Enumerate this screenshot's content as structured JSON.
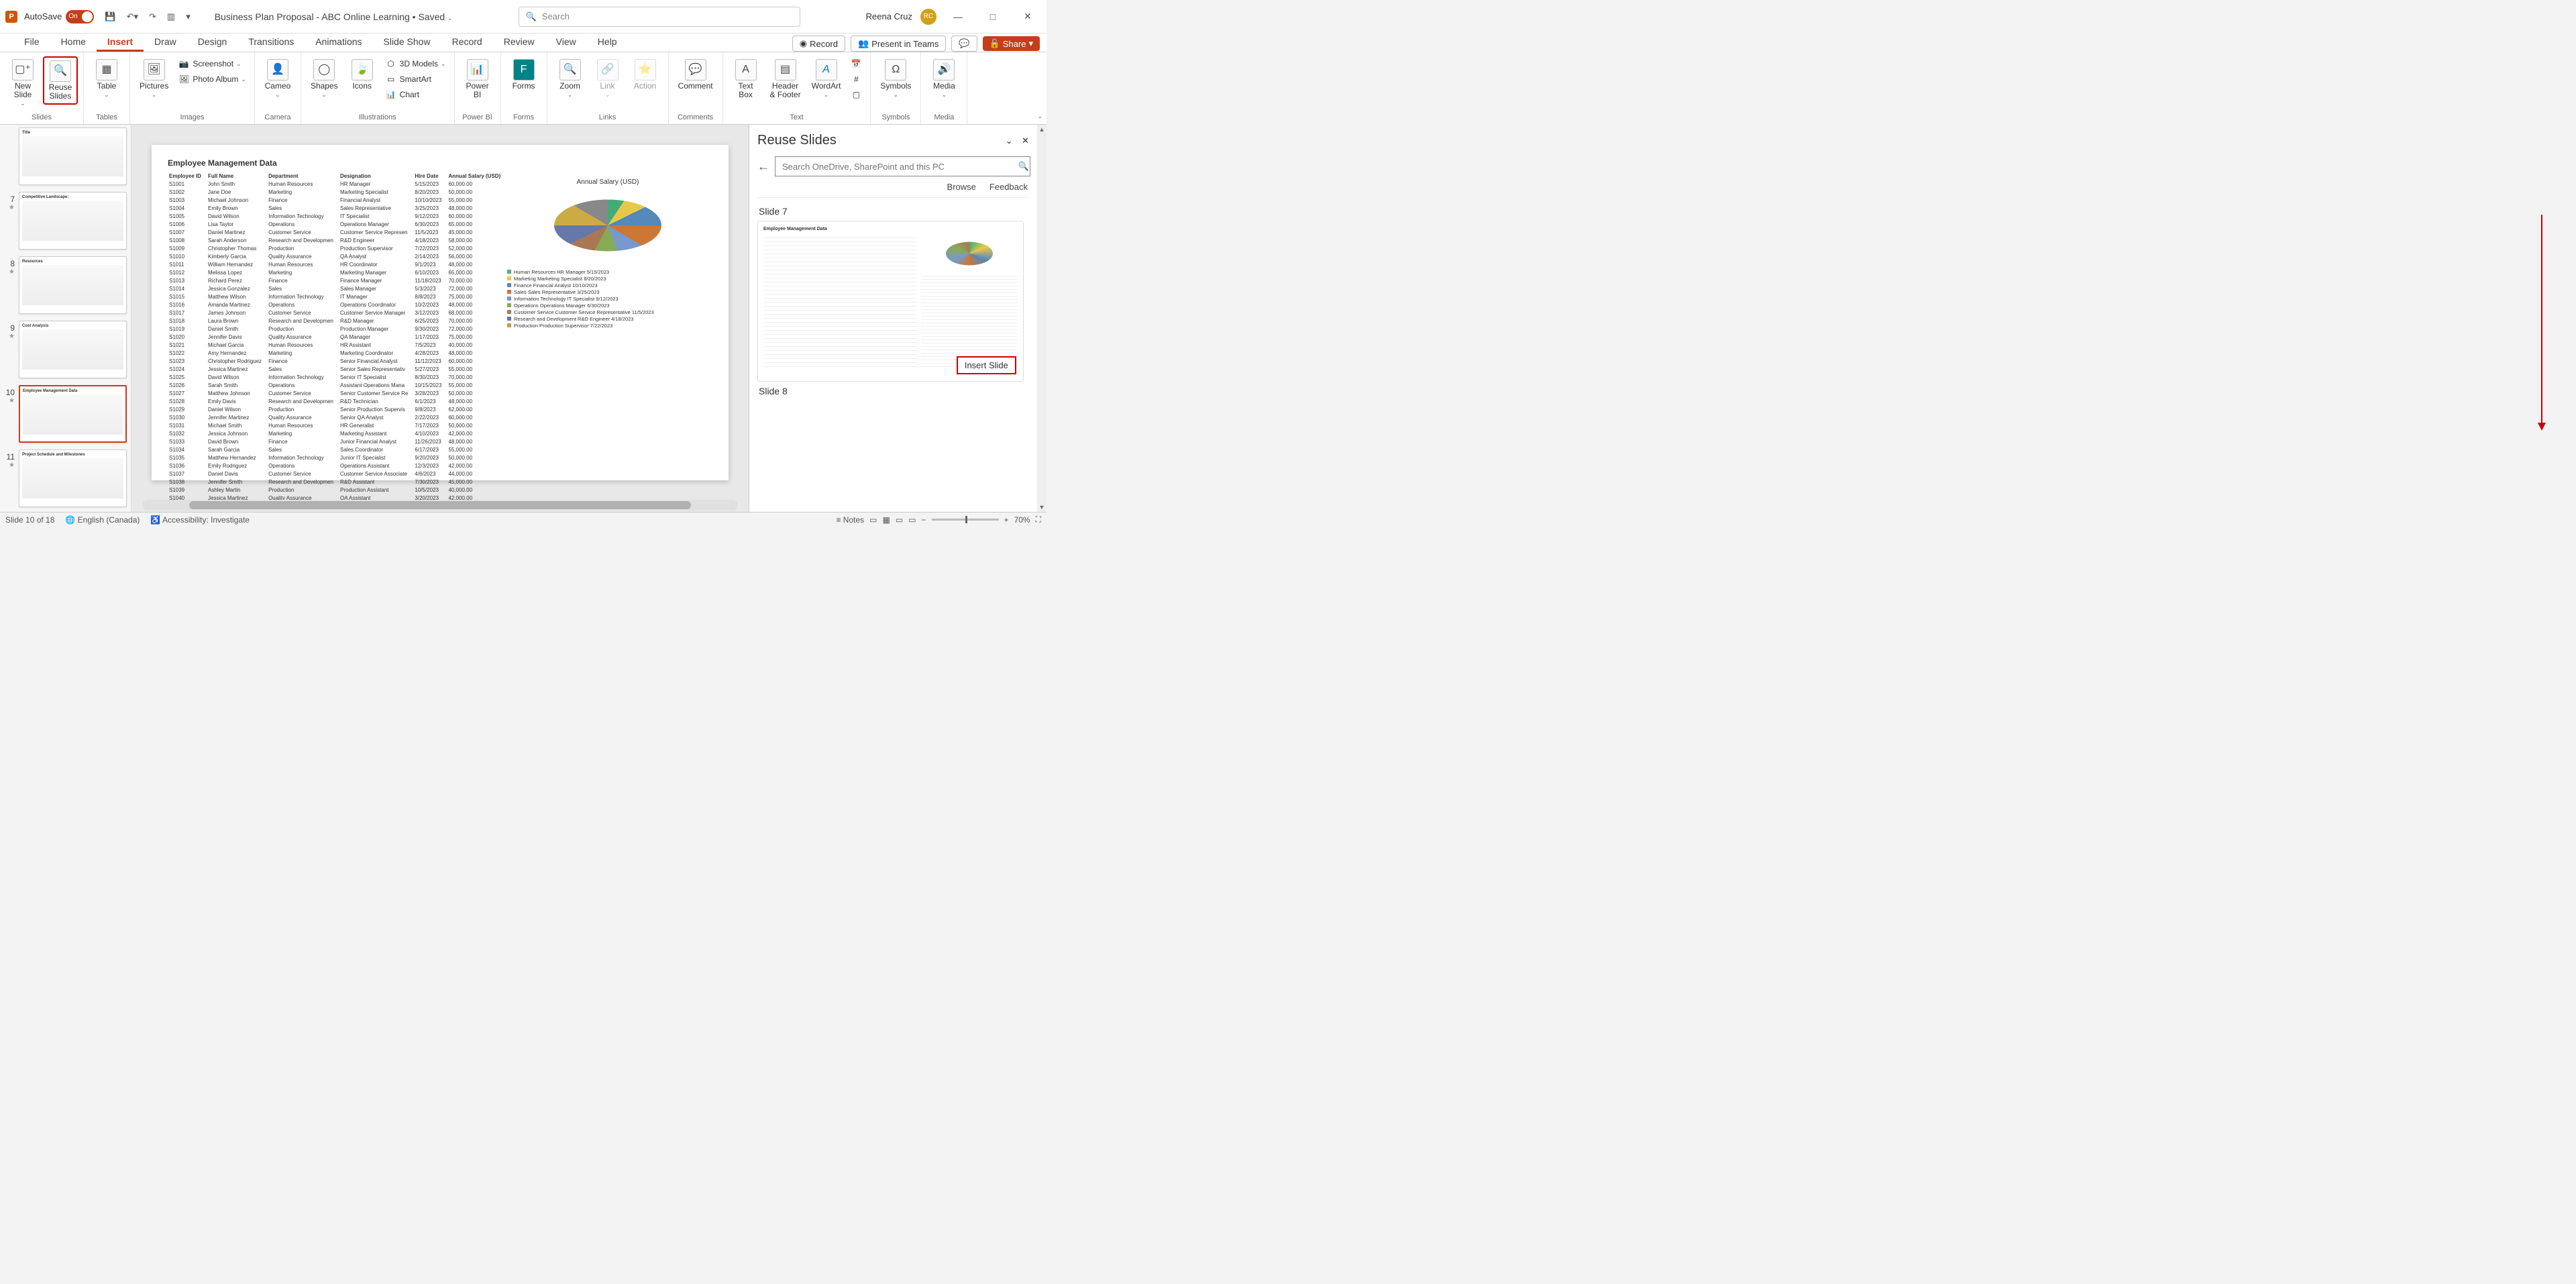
{
  "titlebar": {
    "autosave_label": "AutoSave",
    "autosave_state": "On",
    "doc_title": "Business Plan Proposal - ABC Online Learning • Saved",
    "search_placeholder": "Search",
    "user_name": "Reena Cruz",
    "user_initials": "RC"
  },
  "tabs": {
    "items": [
      "File",
      "Home",
      "Insert",
      "Draw",
      "Design",
      "Transitions",
      "Animations",
      "Slide Show",
      "Record",
      "Review",
      "View",
      "Help"
    ],
    "active": "Insert",
    "record_btn": "Record",
    "present_btn": "Present in Teams",
    "share_btn": "Share"
  },
  "ribbon": {
    "groups": {
      "slides": {
        "label": "Slides",
        "new_slide": "New\nSlide",
        "reuse": "Reuse\nSlides"
      },
      "tables": {
        "label": "Tables",
        "table": "Table"
      },
      "images": {
        "label": "Images",
        "pictures": "Pictures",
        "screenshot": "Screenshot",
        "photo_album": "Photo Album"
      },
      "camera": {
        "label": "Camera",
        "cameo": "Cameo"
      },
      "illustrations": {
        "label": "Illustrations",
        "shapes": "Shapes",
        "icons": "Icons",
        "models": "3D Models",
        "smartart": "SmartArt",
        "chart": "Chart"
      },
      "powerbi": {
        "label": "Power BI",
        "btn": "Power\nBI"
      },
      "forms": {
        "label": "Forms",
        "btn": "Forms"
      },
      "links": {
        "label": "Links",
        "zoom": "Zoom",
        "link": "Link",
        "action": "Action"
      },
      "comments": {
        "label": "Comments",
        "btn": "Comment"
      },
      "text": {
        "label": "Text",
        "textbox": "Text\nBox",
        "headerfooter": "Header\n& Footer",
        "wordart": "WordArt"
      },
      "symbols": {
        "label": "Symbols",
        "btn": "Symbols"
      },
      "media": {
        "label": "Media",
        "btn": "Media"
      }
    }
  },
  "thumbs": {
    "visible": [
      {
        "num": "",
        "title": "Title"
      },
      {
        "num": "7",
        "title": "Competitive Landscape:"
      },
      {
        "num": "8",
        "title": "Resources"
      },
      {
        "num": "9",
        "title": "Cost Analysis"
      },
      {
        "num": "10",
        "title": "Employee Management Data",
        "selected": true
      },
      {
        "num": "11",
        "title": "Project Schedule and Milestones"
      }
    ]
  },
  "slide": {
    "title": "Employee Management Data",
    "columns": [
      "Employee ID",
      "Full Name",
      "Department",
      "Designation",
      "Hire Date",
      "Annual Salary (USD)"
    ],
    "rows": [
      [
        "S1001",
        "John Smith",
        "Human Resources",
        "HR Manager",
        "5/15/2023",
        "60,000.00"
      ],
      [
        "S1002",
        "Jane Doe",
        "Marketing",
        "Marketing Specialist",
        "8/20/2023",
        "50,000.00"
      ],
      [
        "S1003",
        "Michael Johnson",
        "Finance",
        "Financial Analyst",
        "10/10/2023",
        "55,000.00"
      ],
      [
        "S1004",
        "Emily Brown",
        "Sales",
        "Sales Representative",
        "3/25/2023",
        "48,000.00"
      ],
      [
        "S1005",
        "David Wilson",
        "Information Technology",
        "IT Specialist",
        "9/12/2023",
        "60,000.00"
      ],
      [
        "S1006",
        "Lisa Taylor",
        "Operations",
        "Operations Manager",
        "6/30/2023",
        "65,000.00"
      ],
      [
        "S1007",
        "Daniel Martinez",
        "Customer Service",
        "Customer Service Represen",
        "11/5/2023",
        "45,000.00"
      ],
      [
        "S1008",
        "Sarah Anderson",
        "Research and Developmen",
        "R&D Engineer",
        "4/18/2023",
        "58,000.00"
      ],
      [
        "S1009",
        "Christopher Thomas",
        "Production",
        "Production Supervisor",
        "7/22/2023",
        "52,000.00"
      ],
      [
        "S1010",
        "Kimberly Garcia",
        "Quality Assurance",
        "QA Analyst",
        "2/14/2023",
        "56,000.00"
      ],
      [
        "S1011",
        "William Hernandez",
        "Human Resources",
        "HR Coordinator",
        "9/1/2023",
        "48,000.00"
      ],
      [
        "S1012",
        "Melissa Lopez",
        "Marketing",
        "Marketing Manager",
        "6/10/2023",
        "65,000.00"
      ],
      [
        "S1013",
        "Richard Perez",
        "Finance",
        "Finance Manager",
        "11/18/2023",
        "70,000.00"
      ],
      [
        "S1014",
        "Jessica Gonzalez",
        "Sales",
        "Sales Manager",
        "5/3/2023",
        "72,000.00"
      ],
      [
        "S1015",
        "Matthew Wilson",
        "Information Technology",
        "IT Manager",
        "8/8/2023",
        "75,000.00"
      ],
      [
        "S1016",
        "Amanda Martinez",
        "Operations",
        "Operations Coordinator",
        "10/2/2023",
        "48,000.00"
      ],
      [
        "S1017",
        "James Johnson",
        "Customer Service",
        "Customer Service Manager",
        "3/12/2023",
        "68,000.00"
      ],
      [
        "S1018",
        "Laura Brown",
        "Research and Developmen",
        "R&D Manager",
        "6/25/2023",
        "70,000.00"
      ],
      [
        "S1019",
        "Daniel Smith",
        "Production",
        "Production Manager",
        "9/30/2023",
        "72,000.00"
      ],
      [
        "S1020",
        "Jennifer Davis",
        "Quality Assurance",
        "QA Manager",
        "1/17/2023",
        "75,000.00"
      ],
      [
        "S1021",
        "Michael Garcia",
        "Human Resources",
        "HR Assistant",
        "7/5/2023",
        "40,000.00"
      ],
      [
        "S1022",
        "Amy Hernandez",
        "Marketing",
        "Marketing Coordinator",
        "4/28/2023",
        "48,000.00"
      ],
      [
        "S1023",
        "Christopher Rodriguez",
        "Finance",
        "Senior Financial Analyst",
        "11/12/2023",
        "60,000.00"
      ],
      [
        "S1024",
        "Jessica Martinez",
        "Sales",
        "Senior Sales Representativ",
        "5/27/2023",
        "55,000.00"
      ],
      [
        "S1025",
        "David Wilson",
        "Information Technology",
        "Senior IT Specialist",
        "8/30/2023",
        "70,000.00"
      ],
      [
        "S1026",
        "Sarah Smith",
        "Operations",
        "Assistant Operations Mana",
        "10/15/2023",
        "55,000.00"
      ],
      [
        "S1027",
        "Matthew Johnson",
        "Customer Service",
        "Senior Customer Service Re",
        "3/28/2023",
        "50,000.00"
      ],
      [
        "S1028",
        "Emily Davis",
        "Research and Developmen",
        "R&D Technician",
        "6/1/2023",
        "48,000.00"
      ],
      [
        "S1029",
        "Daniel Wilson",
        "Production",
        "Senior Production Supervis",
        "9/8/2023",
        "62,000.00"
      ],
      [
        "S1030",
        "Jennifer Martinez",
        "Quality Assurance",
        "Senior QA Analyst",
        "2/22/2023",
        "60,000.00"
      ],
      [
        "S1031",
        "Michael Smith",
        "Human Resources",
        "HR Generalist",
        "7/17/2023",
        "50,000.00"
      ],
      [
        "S1032",
        "Jessica Johnson",
        "Marketing",
        "Marketing Assistant",
        "4/10/2023",
        "42,000.00"
      ],
      [
        "S1033",
        "David Brown",
        "Finance",
        "Junior Financial Analyst",
        "11/26/2023",
        "48,000.00"
      ],
      [
        "S1034",
        "Sarah Garcia",
        "Sales",
        "Sales Coordinator",
        "6/17/2023",
        "55,000.00"
      ],
      [
        "S1035",
        "Matthew Hernandez",
        "Information Technology",
        "Junior IT Specialist",
        "9/20/2023",
        "50,000.00"
      ],
      [
        "S1036",
        "Emily Rodriguez",
        "Operations",
        "Operations Assistant",
        "12/3/2023",
        "42,000.00"
      ],
      [
        "S1037",
        "Daniel Davis",
        "Customer Service",
        "Customer Service Associate",
        "4/6/2023",
        "44,000.00"
      ],
      [
        "S1038",
        "Jennifer Smith",
        "Research and Developmen",
        "R&D Assistant",
        "7/30/2023",
        "45,000.00"
      ],
      [
        "S1039",
        "Ashley Martin",
        "Production",
        "Production Assistant",
        "10/5/2023",
        "40,000.00"
      ],
      [
        "S1040",
        "Jessica Martinez",
        "Quality Assurance",
        "QA Assistant",
        "3/20/2023",
        "42,000.00"
      ]
    ],
    "chart_title": "Annual Salary (USD)",
    "legend": [
      "Human Resources HR Manager 5/15/2023",
      "Marketing Marketing Specialist 8/20/2023",
      "Finance Financial Analyst 10/10/2023",
      "Sales Sales Representative 3/25/2023",
      "Information Technology IT Specialist 9/12/2023",
      "Operations Operations Manager 6/30/2023",
      "Customer Service Customer Service Representative 11/5/2023",
      "Research and Development R&D Engineer 4/18/2023",
      "Production Production Supervisor 7/22/2023"
    ]
  },
  "reuse": {
    "title": "Reuse Slides",
    "search_placeholder": "Search OneDrive, SharePoint and this PC",
    "browse": "Browse",
    "feedback": "Feedback",
    "slide7_label": "Slide 7",
    "slide8_label": "Slide 8",
    "insert_btn": "Insert Slide"
  },
  "statusbar": {
    "slide_info": "Slide 10 of 18",
    "lang": "English (Canada)",
    "accessibility": "Accessibility: Investigate",
    "notes": "Notes",
    "zoom": "70%"
  }
}
